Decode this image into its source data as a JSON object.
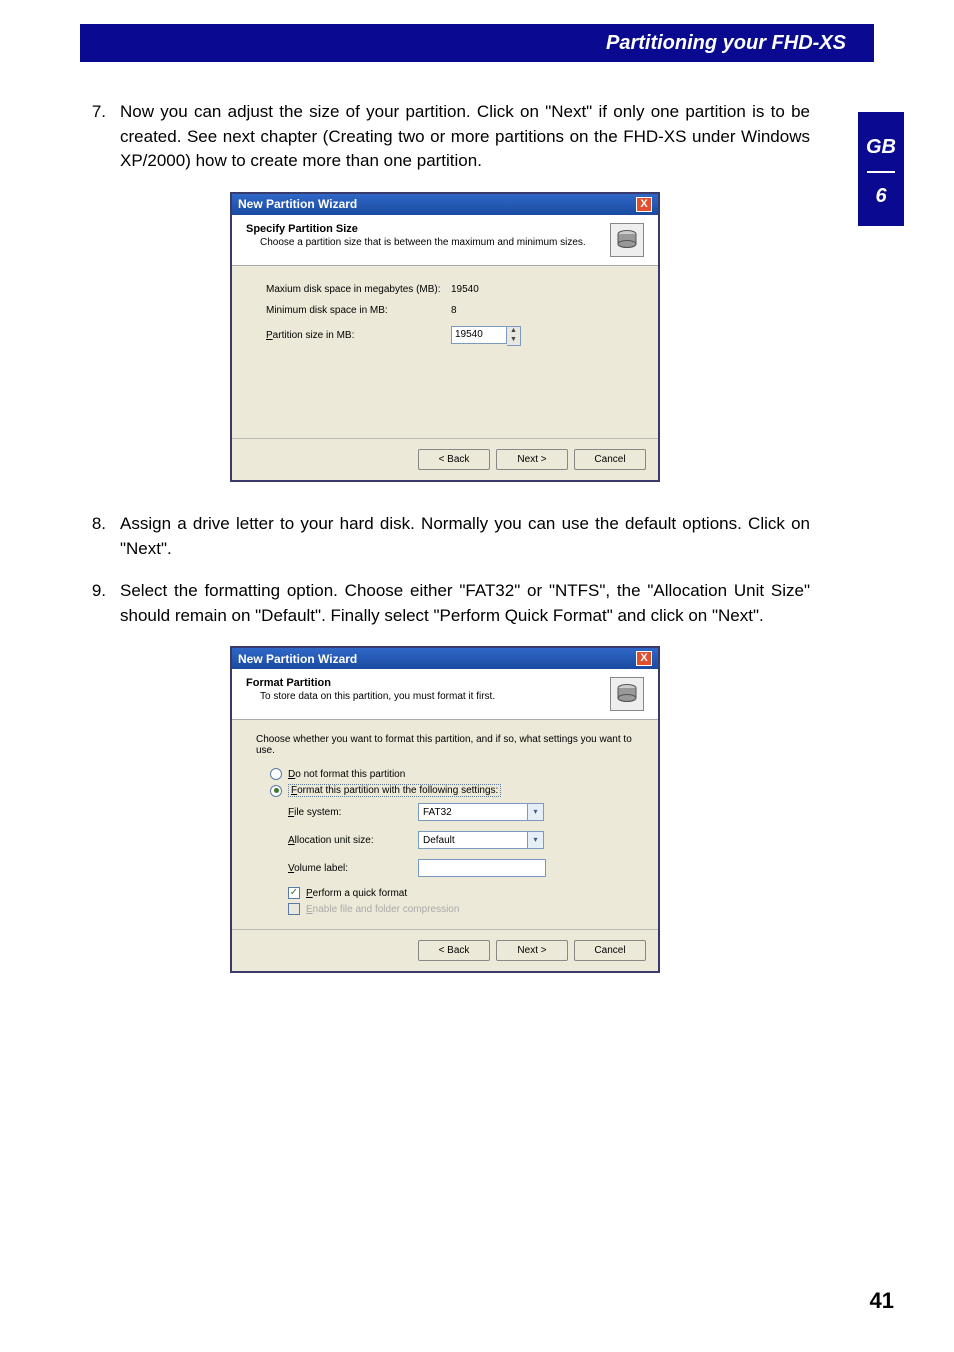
{
  "header": {
    "title": "Partitioning your FHD-XS"
  },
  "sidetab": {
    "lang": "GB",
    "chapter": "6"
  },
  "steps": {
    "s7": {
      "num": "7.",
      "text": "Now you can adjust the size of your partition. Click on \"Next\" if only one partition is to be created. See next chapter (Creating two or more partitions on the FHD-XS under Windows XP/2000) how to create more than one partition."
    },
    "s8": {
      "num": "8.",
      "text": "Assign a drive letter to your hard disk. Normally you can use the default options. Click on \"Next\"."
    },
    "s9": {
      "num": "9.",
      "text": "Select the formatting option. Choose either \"FAT32\" or \"NTFS\", the \"Allocation Unit Size\" should remain on \"Default\". Finally select \"Perform Quick Format\" and click on \"Next\"."
    }
  },
  "dialog1": {
    "title": "New Partition Wizard",
    "close": "X",
    "heading": "Specify Partition Size",
    "subheading": "Choose a partition size that is between the maximum and minimum sizes.",
    "max_lbl": "Maxium disk space in megabytes (MB):",
    "max_val": "19540",
    "min_lbl": "Minimum disk space in MB:",
    "min_val": "8",
    "size_lbl_pre": "P",
    "size_lbl": "artition size in MB:",
    "size_val": "19540",
    "back": "< Back",
    "next": "Next >",
    "cancel": "Cancel"
  },
  "dialog2": {
    "title": "New Partition Wizard",
    "close": "X",
    "heading": "Format Partition",
    "subheading": "To store data on this partition, you must format it first.",
    "desc": "Choose whether you want to format this partition, and if so, what settings you want to use.",
    "opt1_pre": "D",
    "opt1": "o not format this partition",
    "opt2_pre": "F",
    "opt2": "ormat this partition with the following settings:",
    "fs_pre": "F",
    "fs_lbl": "ile system:",
    "fs_val": "FAT32",
    "au_pre": "A",
    "au_lbl": "llocation unit size:",
    "au_val": "Default",
    "vl_pre": "V",
    "vl_lbl": "olume label:",
    "vl_val": "",
    "qf_pre": "P",
    "qf_lbl": "erform a quick format",
    "comp_pre": "E",
    "comp_lbl": "nable file and folder compression",
    "back": "< Back",
    "next": "Next >",
    "cancel": "Cancel"
  },
  "page_num": "41"
}
